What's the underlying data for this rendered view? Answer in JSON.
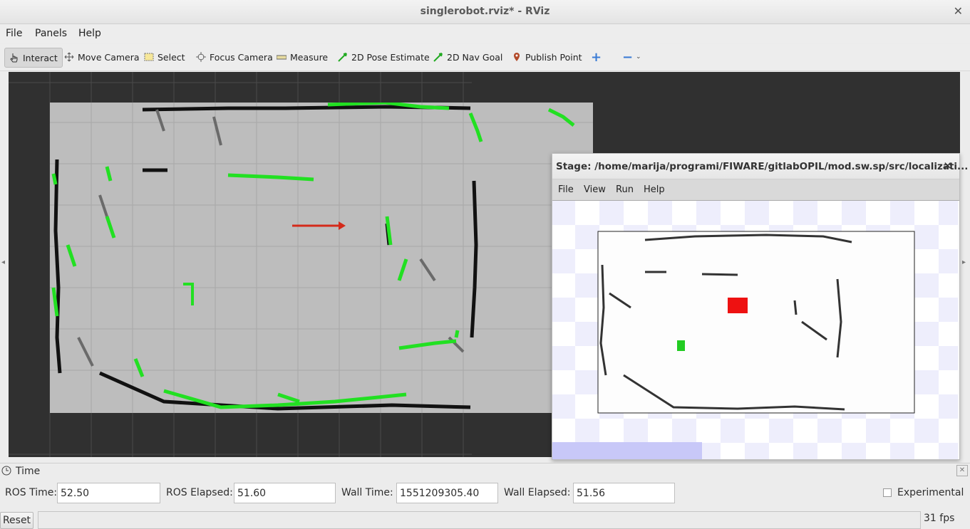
{
  "window": {
    "title": "singlerobot.rviz* - RViz",
    "close": "✕"
  },
  "menu": [
    "File",
    "Panels",
    "Help"
  ],
  "toolbar": {
    "interact": "Interact",
    "move_camera": "Move Camera",
    "select": "Select",
    "focus_camera": "Focus Camera",
    "measure": "Measure",
    "pose_estimate": "2D Pose Estimate",
    "nav_goal": "2D Nav Goal",
    "publish_point": "Publish Point",
    "add": "+",
    "remove": "−"
  },
  "stage": {
    "title": "Stage: /home/marija/programi/FIWARE/gitlabOPIL/mod.sw.sp/src/localizati...",
    "close": "✕",
    "menu": [
      "File",
      "View",
      "Run",
      "Help"
    ]
  },
  "time_panel": {
    "title": "Time",
    "ros_time_label": "ROS Time:",
    "ros_time": "52.50",
    "ros_elapsed_label": "ROS Elapsed:",
    "ros_elapsed": "51.60",
    "wall_time_label": "Wall Time:",
    "wall_time": "1551209305.40",
    "wall_elapsed_label": "Wall Elapsed:",
    "wall_elapsed": "51.56",
    "experimental": "Experimental"
  },
  "status": {
    "reset": "Reset",
    "fps": "31 fps"
  },
  "colors": {
    "laser": "#22e022",
    "robot_arrow": "#d42a1a",
    "stage_robot": "#e11",
    "stage_goal": "#2c2",
    "viewport_bg": "#303030",
    "map_bg": "#bdbdbd"
  }
}
